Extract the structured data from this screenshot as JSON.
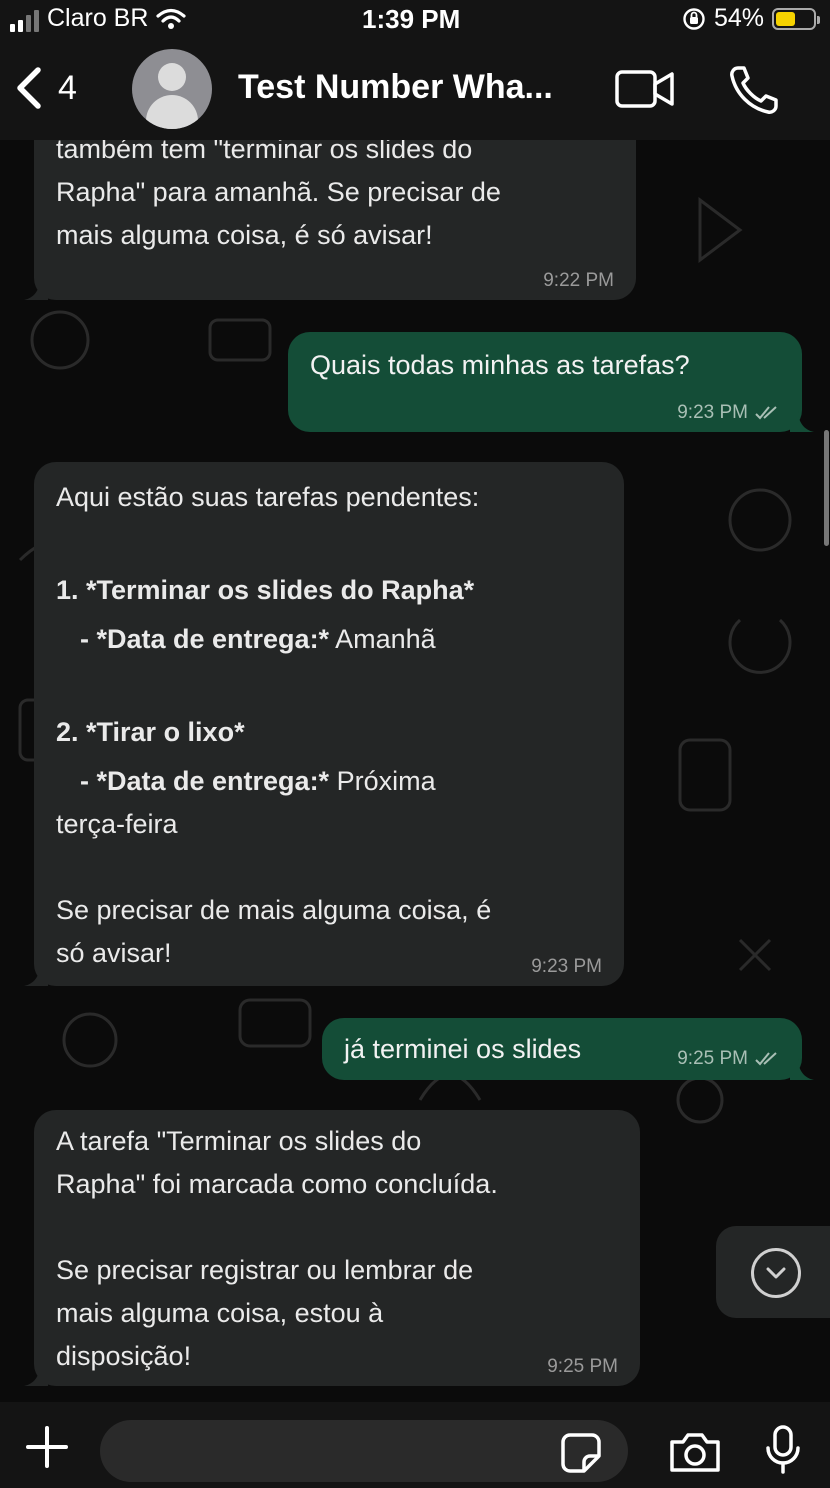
{
  "status_bar": {
    "carrier": "Claro BR",
    "time": "1:39 PM",
    "battery_percent": "54%",
    "battery_level": 0.54,
    "icons": [
      "signal-icon",
      "wifi-icon",
      "orientation-lock-icon",
      "battery-icon"
    ]
  },
  "header": {
    "back_count": "4",
    "contact_name": "Test Number Wha...",
    "icons": [
      "back-chevron-icon",
      "avatar",
      "video-call-icon",
      "phone-call-icon"
    ]
  },
  "messages": [
    {
      "direction": "in",
      "lines": [
        "também tem \"terminar os slides do",
        "Rapha\" para amanhã. Se precisar de",
        "mais alguma coisa, é só avisar!"
      ],
      "time": "9:22 PM"
    },
    {
      "direction": "out",
      "text": "Quais todas minhas as tarefas?",
      "time": "9:23 PM",
      "status": "read"
    },
    {
      "direction": "in",
      "intro": "Aqui estão suas tarefas pendentes:",
      "item1_title": "1. *Terminar os slides do Rapha*",
      "item1_label": "- *Data de entrega:*",
      "item1_value": " Amanhã",
      "item2_title": "2. *Tirar o lixo*",
      "item2_label": "- *Data de entrega:*",
      "item2_value": " Próxima",
      "item2_cont": "terça-feira",
      "outro_1": "Se precisar de mais alguma coisa, é",
      "outro_2": "só avisar!",
      "time": "9:23 PM"
    },
    {
      "direction": "out",
      "text": "já terminei os slides",
      "time": "9:25 PM",
      "status": "read"
    },
    {
      "direction": "in",
      "lines_1": [
        "A tarefa \"Terminar os slides do",
        "Rapha\" foi marcada como concluída."
      ],
      "lines_2": [
        "Se precisar registrar ou lembrar de",
        "mais alguma coisa, estou à",
        "disposição!"
      ],
      "time": "9:25 PM"
    }
  ],
  "input_bar": {
    "placeholder": "",
    "icons": [
      "plus-icon",
      "sticker-icon",
      "camera-icon",
      "microphone-icon"
    ]
  },
  "colors": {
    "incoming_bubble": "#242626",
    "outgoing_bubble": "#144d37",
    "background": "#0b0b0b",
    "bar": "#141414"
  }
}
